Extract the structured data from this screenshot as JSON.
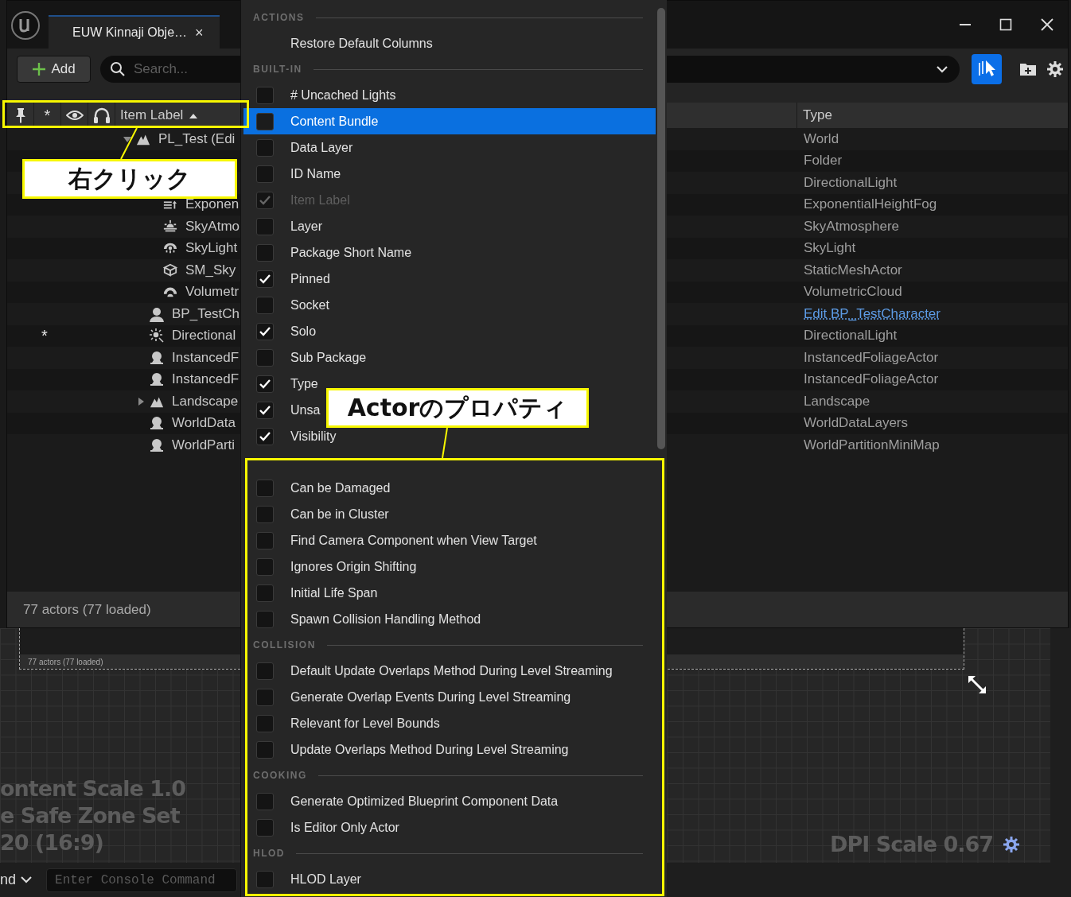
{
  "window": {
    "tab_title": "EUW Kinnaji Obje…",
    "tab_close": "×"
  },
  "toolbar": {
    "add_button": "Add",
    "search": {
      "placeholder": "Search..."
    }
  },
  "outliner": {
    "columns": {
      "star": "*",
      "label": "Item Label",
      "type": "Type"
    },
    "rows": [
      {
        "label": "PL_Test (Edi",
        "type": "World",
        "kind": "landscape",
        "expanded": true,
        "type_link": false,
        "children": [
          {
            "type": "Folder",
            "type_link": false,
            "children": [
              {
                "type": "DirectionalLight",
                "type_link": false
              },
              {
                "label": "Exponen",
                "type": "ExponentialHeightFog",
                "kind": "fog",
                "type_link": false
              },
              {
                "label": "SkyAtmo",
                "type": "SkyAtmosphere",
                "kind": "sky",
                "type_link": false
              },
              {
                "label": "SkyLight",
                "type": "SkyLight",
                "kind": "skylight",
                "type_link": false
              },
              {
                "label": "SM_Sky",
                "type": "StaticMeshActor",
                "kind": "mesh",
                "type_link": false
              },
              {
                "label": "Volumetr",
                "type": "VolumetricCloud",
                "kind": "cloud",
                "type_link": false
              }
            ]
          },
          {
            "label": "BP_TestCh",
            "type": "Edit BP_TestCharacter",
            "kind": "character",
            "type_link": true
          },
          {
            "label": "Directional",
            "type": "DirectionalLight",
            "kind": "light",
            "star": "*",
            "type_link": false
          },
          {
            "label": "InstancedF",
            "type": "InstancedFoliageActor",
            "kind": "actor",
            "type_link": false
          },
          {
            "label": "InstancedF",
            "type": "InstancedFoliageActor",
            "kind": "actor",
            "type_link": false
          },
          {
            "label": "Landscape",
            "type": "Landscape",
            "kind": "landscape",
            "expanded": false,
            "type_link": false
          },
          {
            "label": "WorldData",
            "type": "WorldDataLayers",
            "kind": "actor",
            "type_link": false
          },
          {
            "label": "WorldParti",
            "type": "WorldPartitionMiniMap",
            "kind": "actor",
            "type_link": false
          }
        ]
      }
    ],
    "status": "77 actors (77 loaded)"
  },
  "menu": {
    "sections": [
      {
        "heading": "ACTIONS",
        "items": [
          {
            "kind": "action",
            "label": "Restore Default Columns",
            "selected": false,
            "disabled": false
          }
        ]
      },
      {
        "heading": "BUILT-IN",
        "items": [
          {
            "kind": "checkbox",
            "label": "# Uncached Lights",
            "checked": false,
            "selected": false,
            "disabled": false
          },
          {
            "kind": "checkbox",
            "label": "Content Bundle",
            "checked": false,
            "selected": true,
            "disabled": false
          },
          {
            "kind": "checkbox",
            "label": "Data Layer",
            "checked": false,
            "selected": false,
            "disabled": false
          },
          {
            "kind": "checkbox",
            "label": "ID Name",
            "checked": false,
            "selected": false,
            "disabled": false
          },
          {
            "kind": "checkbox",
            "label": "Item Label",
            "checked": true,
            "selected": false,
            "disabled": true
          },
          {
            "kind": "checkbox",
            "label": "Layer",
            "checked": false,
            "selected": false,
            "disabled": false
          },
          {
            "kind": "checkbox",
            "label": "Package Short Name",
            "checked": false,
            "selected": false,
            "disabled": false
          },
          {
            "kind": "checkbox",
            "label": "Pinned",
            "checked": true,
            "selected": false,
            "disabled": false
          },
          {
            "kind": "checkbox",
            "label": "Socket",
            "checked": false,
            "selected": false,
            "disabled": false
          },
          {
            "kind": "checkbox",
            "label": "Solo",
            "checked": true,
            "selected": false,
            "disabled": false
          },
          {
            "kind": "checkbox",
            "label": "Sub Package",
            "checked": false,
            "selected": false,
            "disabled": false
          },
          {
            "kind": "checkbox",
            "label": "Type",
            "checked": true,
            "selected": false,
            "disabled": false
          },
          {
            "kind": "checkbox",
            "label": "Unsa",
            "checked": true,
            "selected": false,
            "disabled": false
          },
          {
            "kind": "checkbox",
            "label": "Visibility",
            "checked": true,
            "selected": false,
            "disabled": false
          }
        ]
      },
      {
        "items": [
          {
            "kind": "checkbox",
            "label": "Can be Damaged",
            "checked": false,
            "selected": false,
            "disabled": false
          },
          {
            "kind": "checkbox",
            "label": "Can be in Cluster",
            "checked": false,
            "selected": false,
            "disabled": false
          },
          {
            "kind": "checkbox",
            "label": "Find Camera Component when View Target",
            "checked": false,
            "selected": false,
            "disabled": false
          },
          {
            "kind": "checkbox",
            "label": "Ignores Origin Shifting",
            "checked": false,
            "selected": false,
            "disabled": false
          },
          {
            "kind": "checkbox",
            "label": "Initial Life Span",
            "checked": false,
            "selected": false,
            "disabled": false
          },
          {
            "kind": "checkbox",
            "label": "Spawn Collision Handling Method",
            "checked": false,
            "selected": false,
            "disabled": false
          }
        ]
      },
      {
        "heading": "COLLISION",
        "items": [
          {
            "kind": "checkbox",
            "label": "Default Update Overlaps Method During Level Streaming",
            "checked": false,
            "selected": false,
            "disabled": false
          },
          {
            "kind": "checkbox",
            "label": "Generate Overlap Events During Level Streaming",
            "checked": false,
            "selected": false,
            "disabled": false
          },
          {
            "kind": "checkbox",
            "label": "Relevant for Level Bounds",
            "checked": false,
            "selected": false,
            "disabled": false
          },
          {
            "kind": "checkbox",
            "label": "Update Overlaps Method During Level Streaming",
            "checked": false,
            "selected": false,
            "disabled": false
          }
        ]
      },
      {
        "heading": "COOKING",
        "items": [
          {
            "kind": "checkbox",
            "label": "Generate Optimized Blueprint Component Data",
            "checked": false,
            "selected": false,
            "disabled": false
          },
          {
            "kind": "checkbox",
            "label": "Is Editor Only Actor",
            "checked": false,
            "selected": false,
            "disabled": false
          }
        ]
      },
      {
        "heading": "HLOD",
        "items": [
          {
            "kind": "checkbox",
            "label": "HLOD Layer",
            "checked": false,
            "selected": false,
            "disabled": false
          }
        ]
      }
    ]
  },
  "annotations": [
    {
      "text": "右クリック"
    },
    {
      "text": "Actorのプロパティ"
    }
  ],
  "preview": {
    "status": "77 actors (77 loaded)",
    "overlay_lines": [
      "ontent Scale 1.0",
      "e Safe Zone Set",
      "20 (16:9)"
    ],
    "dpi": "DPI Scale 0.67"
  },
  "console": {
    "mode": "nd",
    "placeholder": "Enter Console Command"
  }
}
